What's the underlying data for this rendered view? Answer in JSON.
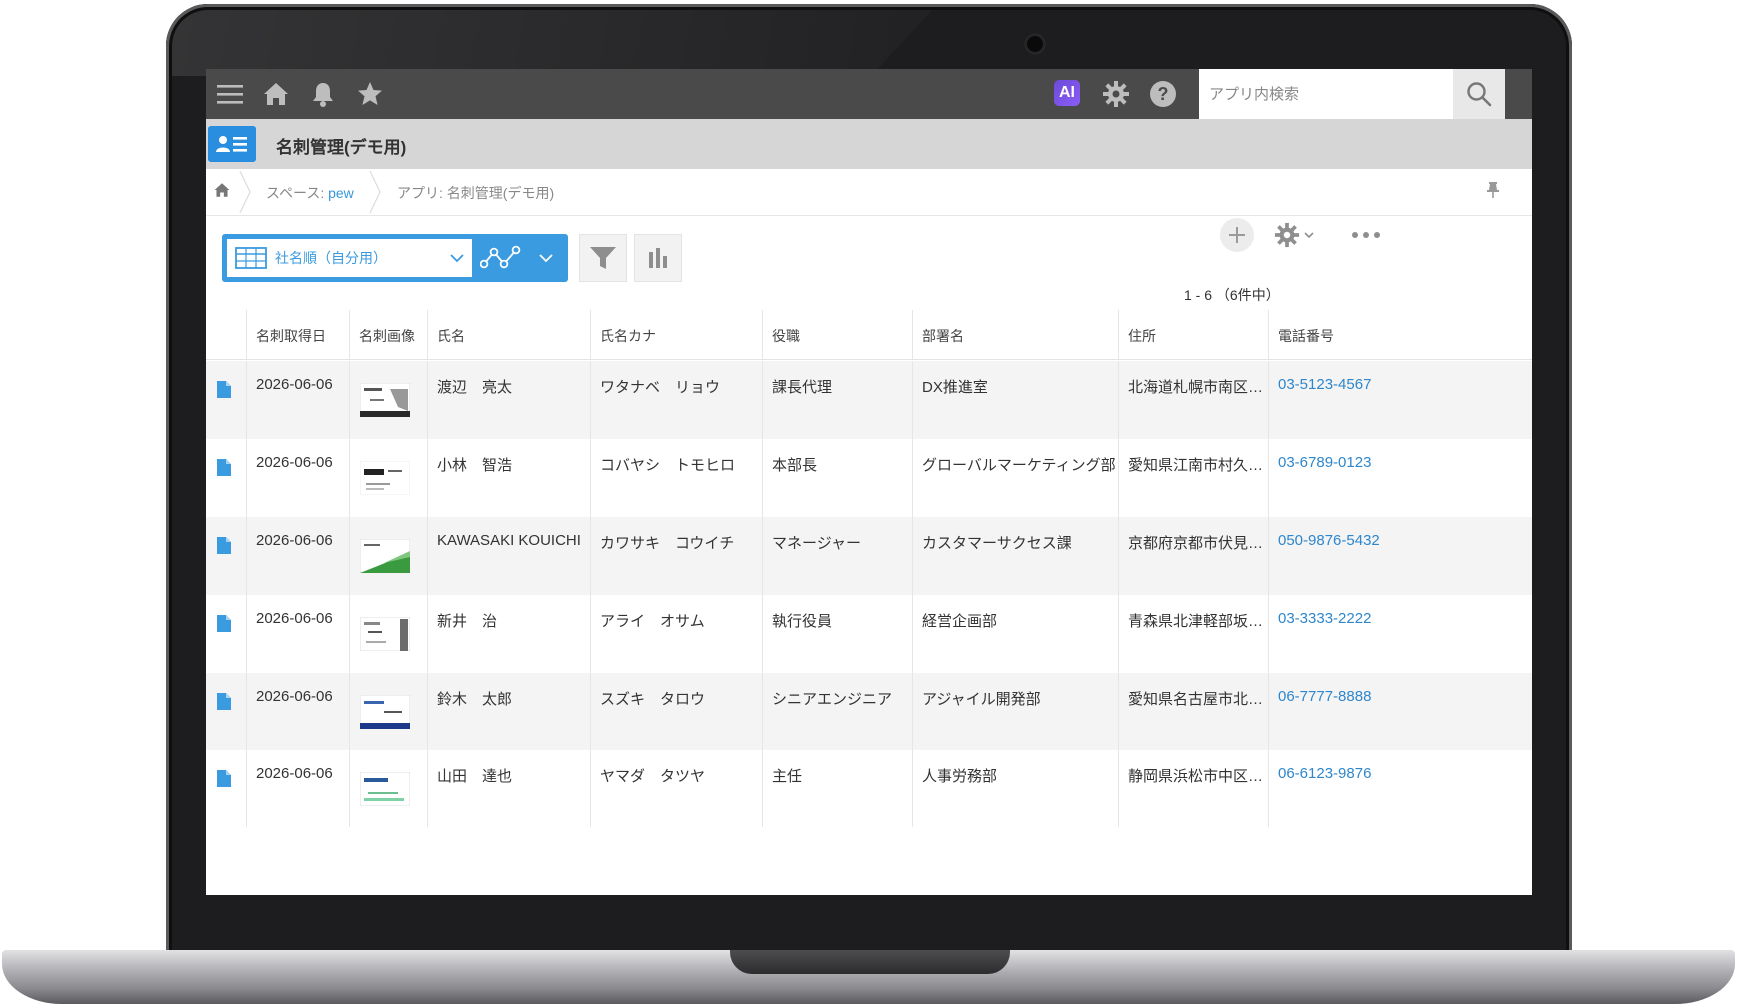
{
  "header": {
    "ai_label": "AI",
    "search_placeholder": "アプリ内検索"
  },
  "app": {
    "title": "名刺管理(デモ用)"
  },
  "breadcrumb": {
    "space_prefix": "スペース: ",
    "space_name": "pew",
    "app_crumb": "アプリ: 名刺管理(デモ用)"
  },
  "toolbar": {
    "view_name": "社名順（自分用）"
  },
  "pager": {
    "text": "1 - 6 （6件中）"
  },
  "table": {
    "columns": [
      "名刺取得日",
      "名刺画像",
      "氏名",
      "氏名カナ",
      "役職",
      "部署名",
      "住所",
      "電話番号"
    ],
    "rows": [
      {
        "date": "2026-06-06",
        "name": "渡辺　亮太",
        "kana": "ワタナベ　リョウ",
        "title": "課長代理",
        "dept": "DX推進室",
        "address": "北海道札幌市南区…",
        "tel": "03-5123-4567"
      },
      {
        "date": "2026-06-06",
        "name": "小林　智浩",
        "kana": "コバヤシ　トモヒロ",
        "title": "本部長",
        "dept": "グローバルマーケティング部",
        "address": "愛知県江南市村久…",
        "tel": "03-6789-0123"
      },
      {
        "date": "2026-06-06",
        "name": "KAWASAKI KOUICHI",
        "kana": "カワサキ　コウイチ",
        "title": "マネージャー",
        "dept": "カスタマーサクセス課",
        "address": "京都府京都市伏見…",
        "tel": "050-9876-5432"
      },
      {
        "date": "2026-06-06",
        "name": "新井　治",
        "kana": "アライ　オサム",
        "title": "執行役員",
        "dept": "経営企画部",
        "address": "青森県北津軽部坂…",
        "tel": "03-3333-2222"
      },
      {
        "date": "2026-06-06",
        "name": "鈴木　太郎",
        "kana": "スズキ　タロウ",
        "title": "シニアエンジニア",
        "dept": "アジャイル開発部",
        "address": "愛知県名古屋市北…",
        "tel": "06-7777-8888"
      },
      {
        "date": "2026-06-06",
        "name": "山田　達也",
        "kana": "ヤマダ　タツヤ",
        "title": "主任",
        "dept": "人事労務部",
        "address": "静岡県浜松市中区…",
        "tel": "06-6123-9876"
      }
    ]
  },
  "colors": {
    "accent": "#3a9be0",
    "topbar": "#4a4a4a",
    "appbar": "#d6d6d6",
    "link": "#2e86cc",
    "ai_badge": "#7c4ddb"
  },
  "icons": {
    "topbar": [
      "menu-icon",
      "home-icon",
      "bell-icon",
      "star-icon",
      "gear-icon",
      "help-icon",
      "search-icon"
    ],
    "app": "business-card-icon",
    "row": "document-icon"
  }
}
